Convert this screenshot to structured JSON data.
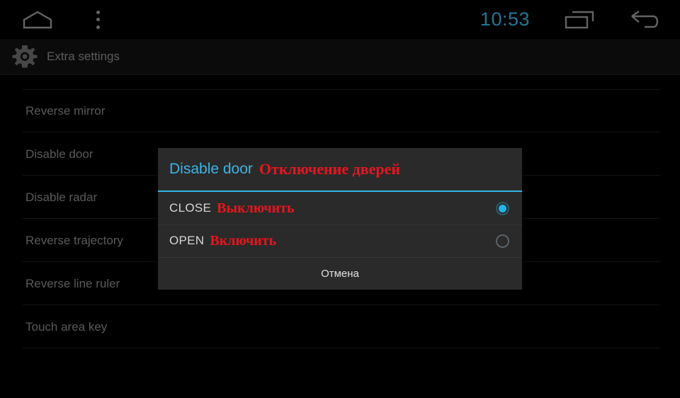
{
  "statusbar": {
    "clock": "10:53",
    "icons": {
      "home": "home-icon",
      "menu": "overflow-menu-icon",
      "recents": "recents-icon",
      "back": "back-icon"
    }
  },
  "actionbar": {
    "icon": "gear-icon",
    "title": "Extra settings"
  },
  "settings_list": {
    "items": [
      {
        "label": "Reverse mirror"
      },
      {
        "label": "Disable door"
      },
      {
        "label": "Disable radar"
      },
      {
        "label": "Reverse trajectory"
      },
      {
        "label": "Reverse line ruler"
      },
      {
        "label": "Touch area key"
      }
    ]
  },
  "dialog": {
    "title_en": "Disable door",
    "title_ru": "Отключение дверей",
    "accent_color": "#33b5e5",
    "ru_text_color": "#e8151d",
    "options": [
      {
        "label_en": "CLOSE",
        "label_ru": "Выключить",
        "selected": true
      },
      {
        "label_en": "OPEN",
        "label_ru": "Включить",
        "selected": false
      }
    ],
    "cancel_label": "Отмена"
  }
}
